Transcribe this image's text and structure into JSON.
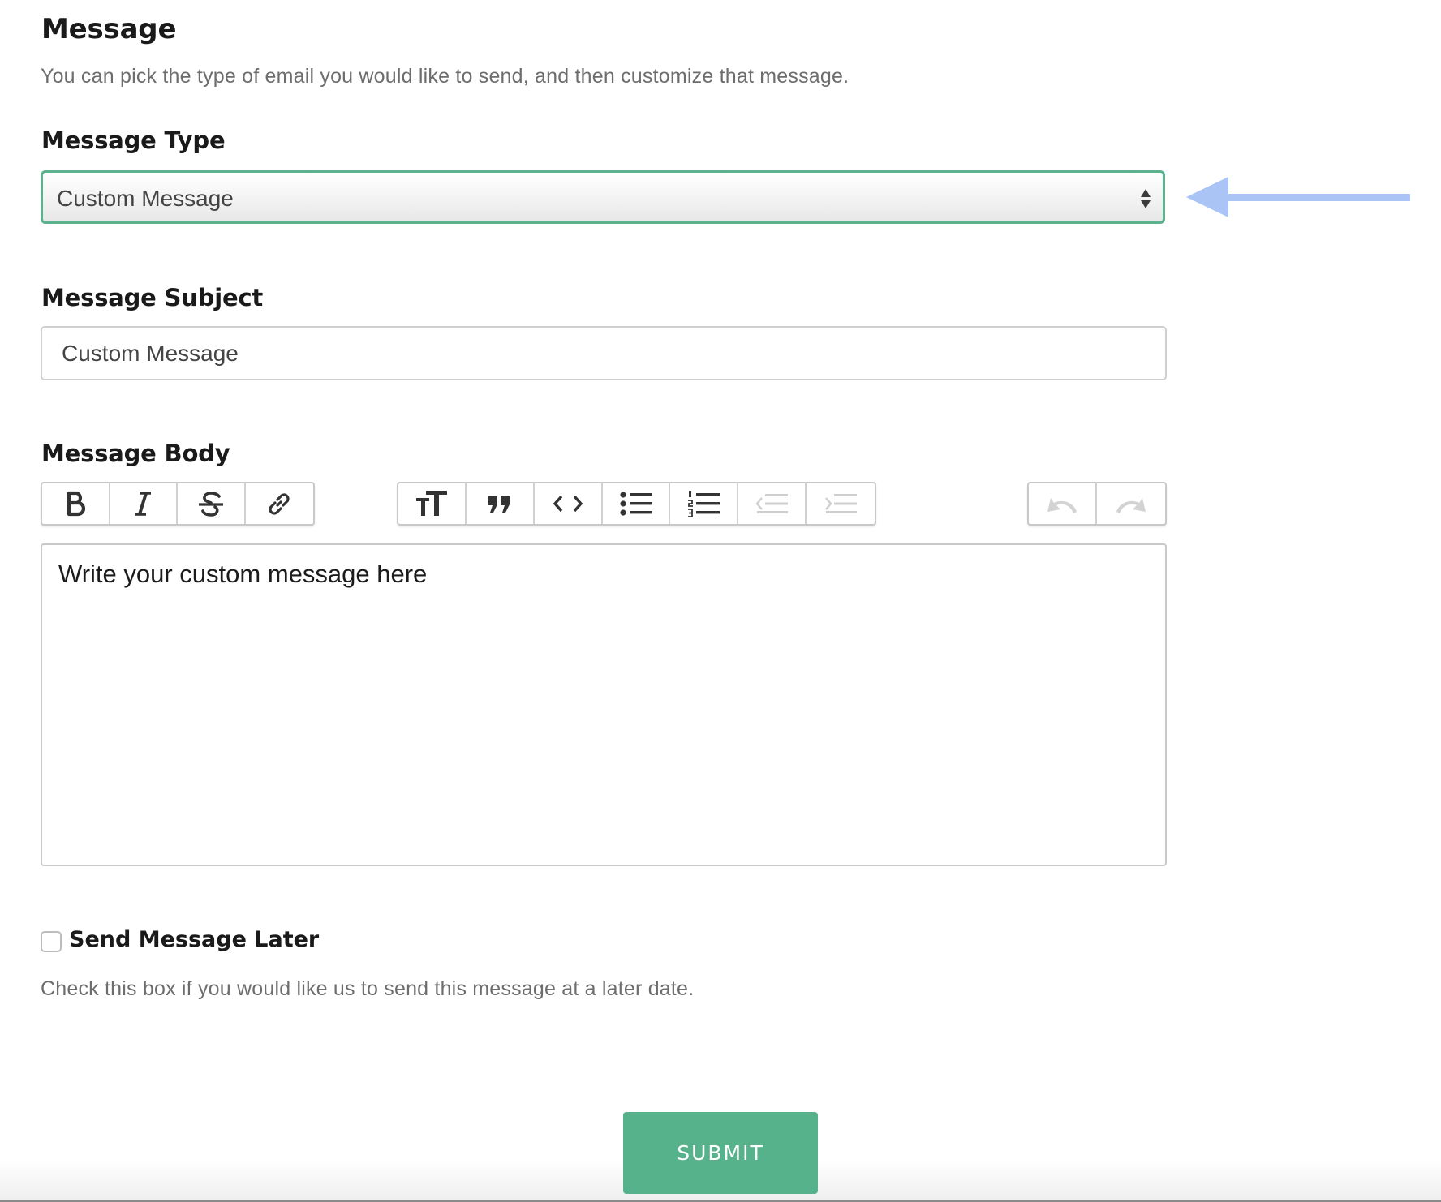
{
  "section": {
    "title": "Message",
    "description": "You can pick the type of email you would like to send, and then customize that message."
  },
  "message_type": {
    "label": "Message Type",
    "selected": "Custom Message"
  },
  "message_subject": {
    "label": "Message Subject",
    "value": "Custom Message"
  },
  "message_body": {
    "label": "Message Body",
    "value": "Write your custom message here",
    "toolbar": {
      "text_group": [
        "bold-icon",
        "italic-icon",
        "strikethrough-icon",
        "link-icon"
      ],
      "block_group": [
        "heading-icon",
        "quote-icon",
        "code-icon",
        "bullet-list-icon",
        "numbered-list-icon",
        "outdent-icon",
        "indent-icon"
      ],
      "history_group": [
        "undo-icon",
        "redo-icon"
      ],
      "disabled": [
        "outdent-icon",
        "indent-icon",
        "undo-icon",
        "redo-icon"
      ]
    }
  },
  "send_later": {
    "label": "Send Message Later",
    "checked": false,
    "help": "Check this box if you would like us to send this message at a later date."
  },
  "submit": {
    "label": "SUBMIT"
  },
  "colors": {
    "accent": "#56b28b",
    "focus_border": "#5cb28c",
    "annotation_arrow": "#a9c4f5",
    "help_text": "#6d6d6d"
  }
}
